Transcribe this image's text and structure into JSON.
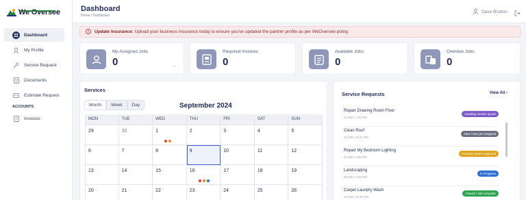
{
  "brand": {
    "name": "We Oversee"
  },
  "sidebar": {
    "items": [
      {
        "label": "Dashboard",
        "icon": "dashboard-icon",
        "active": true
      },
      {
        "label": "My Profile",
        "icon": "user-icon"
      },
      {
        "label": "Service Request",
        "icon": "wrench-icon"
      },
      {
        "label": "Documents",
        "icon": "document-icon"
      },
      {
        "label": "Estimate Request",
        "icon": "estimate-icon"
      }
    ],
    "section": "ACCOUNTS",
    "account_items": [
      {
        "label": "Invoices",
        "icon": "invoice-icon"
      }
    ]
  },
  "header": {
    "title": "Dashboard",
    "breadcrumb": "Home / Dashboard",
    "user_name": "Dave Brutton"
  },
  "alert": {
    "title": "Update Insurance:",
    "message": "Upload your business insurance today to ensure you've updated the partner profile as per WeOversee policy."
  },
  "stats": [
    {
      "label": "My Assigned Jobs",
      "value": "0"
    },
    {
      "label": "Required Invoices",
      "value": "0"
    },
    {
      "label": "Available Jobs",
      "value": "0"
    },
    {
      "label": "Overdue Jobs",
      "value": "0"
    }
  ],
  "services": {
    "title": "Services",
    "tabs": [
      "Month",
      "Week",
      "Day"
    ],
    "month_title": "September 2024",
    "weekdays": [
      "MON",
      "TUE",
      "WED",
      "THU",
      "FRI",
      "SAT",
      "SUN"
    ],
    "weeks": [
      [
        "29",
        "30",
        "1",
        "2",
        "3",
        "4",
        "5"
      ],
      [
        "6",
        "7",
        "8",
        "9",
        "10",
        "11",
        "12"
      ],
      [
        "13",
        "14",
        "15",
        "16",
        "17",
        "18",
        "19"
      ],
      [
        "20",
        "21",
        "22",
        "23",
        "24",
        "25",
        "26"
      ]
    ],
    "event_colors": {
      "orange": "#e58a1f",
      "red": "#d6453d",
      "blue": "#2f6fd0"
    }
  },
  "requests": {
    "title": "Service Requests",
    "view_all": "View All",
    "items": [
      {
        "name": "Repair Drawing Room Floor",
        "date": "22 DEC 7:20 PM",
        "status": "Awaiting Vendor Quote",
        "color": "#7a5ac9"
      },
      {
        "name": "Clean Roof",
        "date": "21 DEC 11:21 PM",
        "status": "New / Not yet Assigned",
        "color": "#6c7080"
      },
      {
        "name": "Repair My Bedroom Lighting",
        "date": "21 DEC 9:28 PM",
        "status": "Pending Owner Approval",
        "color": "#e0a21a"
      },
      {
        "name": "Landscaping",
        "date": "20 DEC 3:52 PM",
        "status": "In Progress",
        "color": "#2f6fd0"
      },
      {
        "name": "Carpet Laundry Wash",
        "date": "19 DEC 11:35 PM",
        "status": "Closed / Job complete",
        "color": "#2ea44f"
      }
    ]
  }
}
